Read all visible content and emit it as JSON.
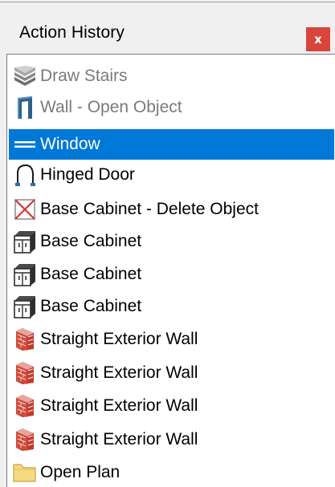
{
  "panel": {
    "title": "Action History",
    "close_label": "x"
  },
  "items": [
    {
      "label": "Draw Stairs",
      "icon": "stairs-icon",
      "state": "dim"
    },
    {
      "label": "Wall - Open Object",
      "icon": "wall-icon",
      "state": "dim"
    },
    {
      "label": "Window",
      "icon": "window-icon",
      "state": "selected"
    },
    {
      "label": "Hinged Door",
      "icon": "hinged-door-icon",
      "state": "normal"
    },
    {
      "label": "Base Cabinet - Delete Object",
      "icon": "delete-object-icon",
      "state": "normal"
    },
    {
      "label": "Base Cabinet",
      "icon": "base-cabinet-icon",
      "state": "normal"
    },
    {
      "label": "Base Cabinet",
      "icon": "base-cabinet-icon",
      "state": "normal"
    },
    {
      "label": "Base Cabinet",
      "icon": "base-cabinet-icon",
      "state": "normal"
    },
    {
      "label": "Straight Exterior Wall",
      "icon": "exterior-wall-icon",
      "state": "normal"
    },
    {
      "label": "Straight Exterior Wall",
      "icon": "exterior-wall-icon",
      "state": "normal"
    },
    {
      "label": "Straight Exterior Wall",
      "icon": "exterior-wall-icon",
      "state": "normal"
    },
    {
      "label": "Straight Exterior Wall",
      "icon": "exterior-wall-icon",
      "state": "normal"
    },
    {
      "label": "Open Plan",
      "icon": "folder-icon",
      "state": "normal"
    }
  ],
  "colors": {
    "selection": "#0078d7",
    "close_button": "#d9453a",
    "dim_text": "#7a7a7a"
  }
}
